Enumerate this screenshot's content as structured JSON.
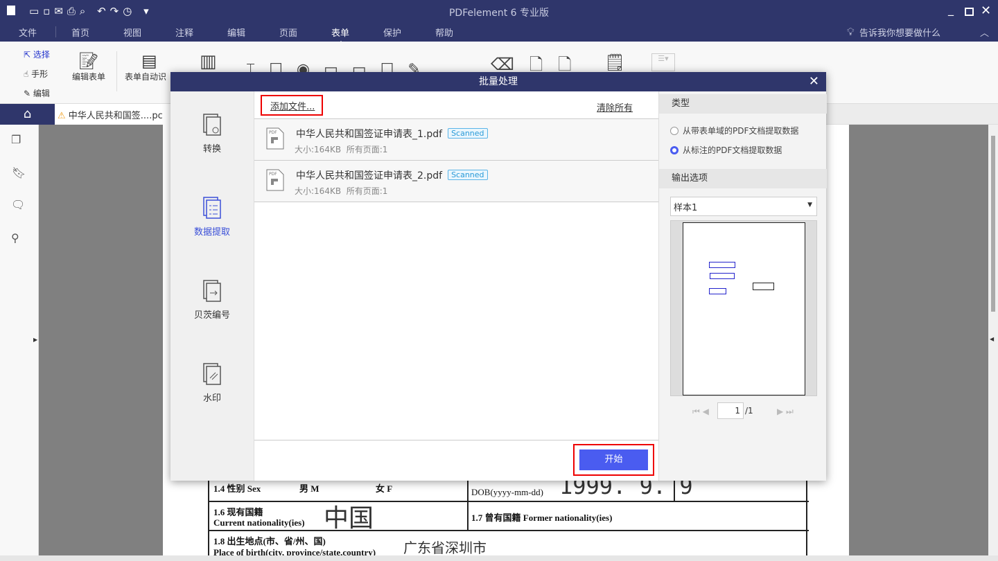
{
  "app": {
    "title": "PDFelement  6 专业版"
  },
  "menu": [
    "文件",
    "首页",
    "视图",
    "注释",
    "编辑",
    "页面",
    "表单",
    "保护",
    "帮助"
  ],
  "menu_active": "表单",
  "tell_me": "告诉我你想要做什么",
  "ribbon": {
    "select": "选择",
    "hand": "手形",
    "edit": "编辑",
    "edit_form": "编辑表单",
    "auto_form": "表单自动识"
  },
  "doc_tab": "中华人民共和国签....pc",
  "dialog": {
    "title": "批量处理",
    "nav": [
      {
        "label": "转换"
      },
      {
        "label": "数据提取"
      },
      {
        "label": "贝茨编号"
      },
      {
        "label": "水印"
      }
    ],
    "add_files": "添加文件...",
    "clear_all": "清除所有",
    "files": [
      {
        "name": "中华人民共和国签证申请表_1.pdf",
        "badge": "Scanned",
        "size": "大小:164KB",
        "pages": "所有页面:1"
      },
      {
        "name": "中华人民共和国签证申请表_2.pdf",
        "badge": "Scanned",
        "size": "大小:164KB",
        "pages": "所有页面:1"
      }
    ],
    "start": "开始",
    "type_label": "类型",
    "options": [
      "从带表单域的PDF文档提取数据",
      "从标注的PDF文档提取数据"
    ],
    "selected_option": 1,
    "output_label": "输出选项",
    "template": "样本1",
    "page_current": "1",
    "page_total": "/1"
  },
  "form": {
    "sex": "1.4 性别 Sex",
    "male": "男 M",
    "female": "女 F",
    "dob": "DOB(yyyy-mm-dd)",
    "dob_val": "1999. 9. 9",
    "nat_cn": "1.6 现有国籍",
    "nat_en": "Current nationality(ies)",
    "nat_val": "中国",
    "former": "1.7 曾有国籍 Former nationality(ies)",
    "birth_cn": "1.8 出生地点(市、省/州、国)",
    "birth_en": "Place of birth(city, province/state,country)",
    "birth_val": "广东省深圳市"
  }
}
